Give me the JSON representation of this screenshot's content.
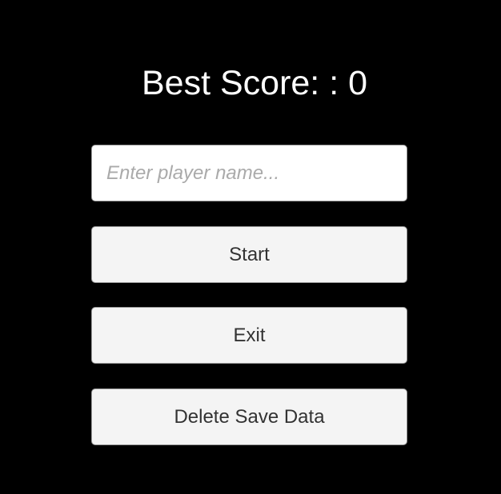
{
  "best_score_label": "Best Score:  : 0",
  "player_name": {
    "value": "",
    "placeholder": "Enter player name..."
  },
  "buttons": {
    "start": "Start",
    "exit": "Exit",
    "delete": "Delete Save Data"
  }
}
